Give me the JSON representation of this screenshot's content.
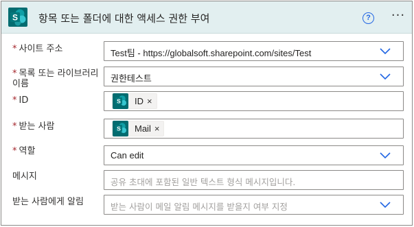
{
  "header": {
    "title": "항목 또는 폴더에 대한 액세스 권한 부여",
    "help_glyph": "?",
    "more_glyph": "···"
  },
  "fields": {
    "site_address": {
      "required_mark": "*",
      "label": "사이트 주소",
      "value": "Test팀 - https://globalsoft.sharepoint.com/sites/Test"
    },
    "list_name": {
      "required_mark": "*",
      "label": "목록 또는 라이브러리 이름",
      "value": "권한테스트"
    },
    "id": {
      "required_mark": "*",
      "label": "ID",
      "token": "ID",
      "remove_glyph": "×"
    },
    "recipients": {
      "required_mark": "*",
      "label": "받는 사람",
      "token": "Mail",
      "remove_glyph": "×"
    },
    "role": {
      "required_mark": "*",
      "label": "역할",
      "value": "Can edit"
    },
    "message": {
      "label": "메시지",
      "placeholder": "공유 초대에 포함된 일반 텍스트 형식 메시지입니다."
    },
    "notify": {
      "label": "받는 사람에게 알림",
      "placeholder": "받는 사람이 메일 알림 메시지를 받을지 여부 지정"
    }
  },
  "icons": {
    "app": "sharepoint-icon",
    "chevron": "chevron-down-icon"
  },
  "colors": {
    "header_bg": "#e2eff0",
    "sharepoint_teal": "#036c70",
    "required": "#a4262c",
    "chevron": "#2266e3",
    "placeholder": "#a19f9d"
  }
}
